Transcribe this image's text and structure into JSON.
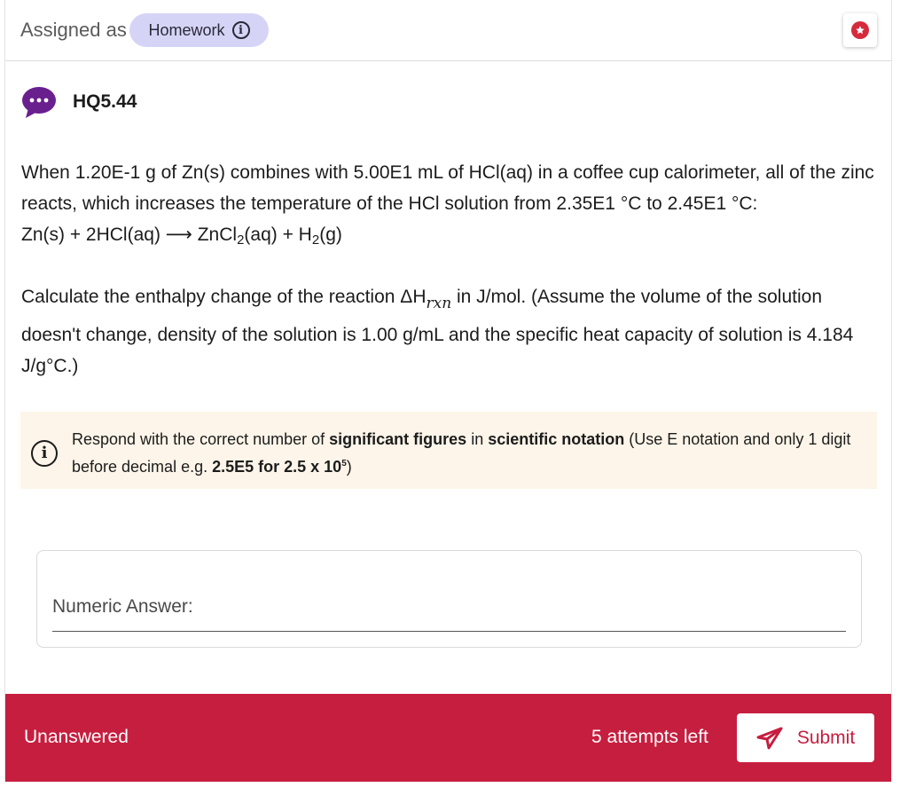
{
  "header": {
    "assigned_label": "Assigned as",
    "assignment_type": "Homework",
    "info_icon": "info-circle-icon",
    "bookmark_icon": "star-icon"
  },
  "question": {
    "id": "HQ5.44",
    "icon": "chat-bubble-icon",
    "paragraph1": {
      "line1": "When 1.20E-1 g of Zn(s) combines with  5.00E1 mL of HCl(aq) in a coffee cup calorimeter, all of the zinc reacts, which increases the temperature of the HCl solution from 2.35E1 °C to 2.45E1 °C:",
      "eq_left": "Zn(s) + 2HCl(aq) ⟶ ZnCl",
      "eq_sub1": "2",
      "eq_mid": "(aq) + H",
      "eq_sub2": "2",
      "eq_right": "(g)"
    },
    "paragraph2": {
      "before": "Calculate the enthalpy change of the reaction ΔH",
      "subscript": "rxn",
      "after": " in J/mol. (Assume the volume of the solution doesn't change,  density of the solution is 1.00 g/mL and the specific heat capacity of solution is 4.184 J/g°C.)"
    }
  },
  "hint": {
    "icon": "info-circle-icon",
    "t1": "Respond with the correct number of ",
    "b1": "significant figures",
    "t2": " in ",
    "b2": "scientific notation",
    "t3": " (Use E notation and only 1 digit before decimal e.g. ",
    "b3": "2.5E5 for 2.5 x 10",
    "b3_sup": "5",
    "t4": ")"
  },
  "answer": {
    "placeholder": "Numeric Answer:",
    "value": ""
  },
  "footer": {
    "status": "Unanswered",
    "attempts": "5 attempts left",
    "submit_label": "Submit",
    "submit_icon": "send-icon",
    "color": "#c61e3f"
  }
}
